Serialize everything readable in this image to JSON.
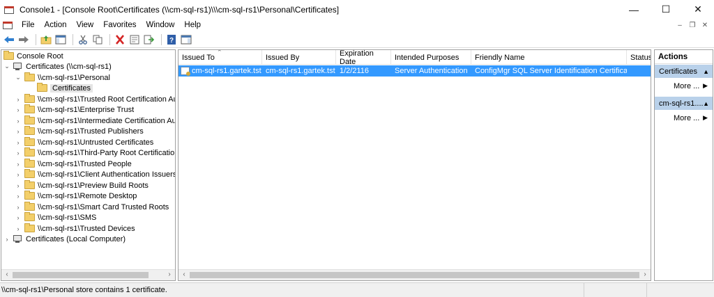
{
  "window": {
    "title": "Console1 - [Console Root\\Certificates (\\\\cm-sql-rs1)\\\\\\cm-sql-rs1\\Personal\\Certificates]",
    "minimize": "—",
    "maximize": "☐",
    "close": "✕"
  },
  "menu": {
    "items": [
      "File",
      "Action",
      "View",
      "Favorites",
      "Window",
      "Help"
    ],
    "mdi_minimize": "–",
    "mdi_restore": "❐",
    "mdi_close": "✕"
  },
  "toolbar": {
    "icons": [
      "back-arrow-icon",
      "forward-arrow-icon",
      "up-folder-icon",
      "show-hide-tree-icon",
      "cut-icon",
      "copy-icon",
      "delete-icon",
      "properties-icon",
      "export-list-icon",
      "help-icon",
      "action-pane-icon"
    ]
  },
  "tree": {
    "root": "Console Root",
    "certificates_remote": "Certificates (\\\\cm-sql-rs1)",
    "personal": "\\\\cm-sql-rs1\\Personal",
    "personal_certificates": "Certificates",
    "stores": [
      "\\\\cm-sql-rs1\\Trusted Root Certification Au",
      "\\\\cm-sql-rs1\\Enterprise Trust",
      "\\\\cm-sql-rs1\\Intermediate Certification Au",
      "\\\\cm-sql-rs1\\Trusted Publishers",
      "\\\\cm-sql-rs1\\Untrusted Certificates",
      "\\\\cm-sql-rs1\\Third-Party Root Certification",
      "\\\\cm-sql-rs1\\Trusted People",
      "\\\\cm-sql-rs1\\Client Authentication Issuers",
      "\\\\cm-sql-rs1\\Preview Build Roots",
      "\\\\cm-sql-rs1\\Remote Desktop",
      "\\\\cm-sql-rs1\\Smart Card Trusted Roots",
      "\\\\cm-sql-rs1\\SMS",
      "\\\\cm-sql-rs1\\Trusted Devices"
    ],
    "local_computer": "Certificates (Local Computer)"
  },
  "list": {
    "columns": [
      "Issued To",
      "Issued By",
      "Expiration Date",
      "Intended Purposes",
      "Friendly Name",
      "Status"
    ],
    "rows": [
      {
        "issued_to": "cm-sql-rs1.gartek.tst",
        "issued_by": "cm-sql-rs1.gartek.tst",
        "expiration": "1/2/2116",
        "purposes": "Server Authentication",
        "friendly_name": "ConfigMgr SQL Server Identification Certificate",
        "status": ""
      }
    ]
  },
  "actions": {
    "title": "Actions",
    "section1": "Certificates",
    "more1": "More ...",
    "section2": "cm-sql-rs1....",
    "more2": "More ..."
  },
  "status_bar": {
    "text": "\\\\cm-sql-rs1\\Personal store contains 1 certificate."
  },
  "colors": {
    "selection": "#3399ff",
    "action_section": "#b9d1ea"
  }
}
